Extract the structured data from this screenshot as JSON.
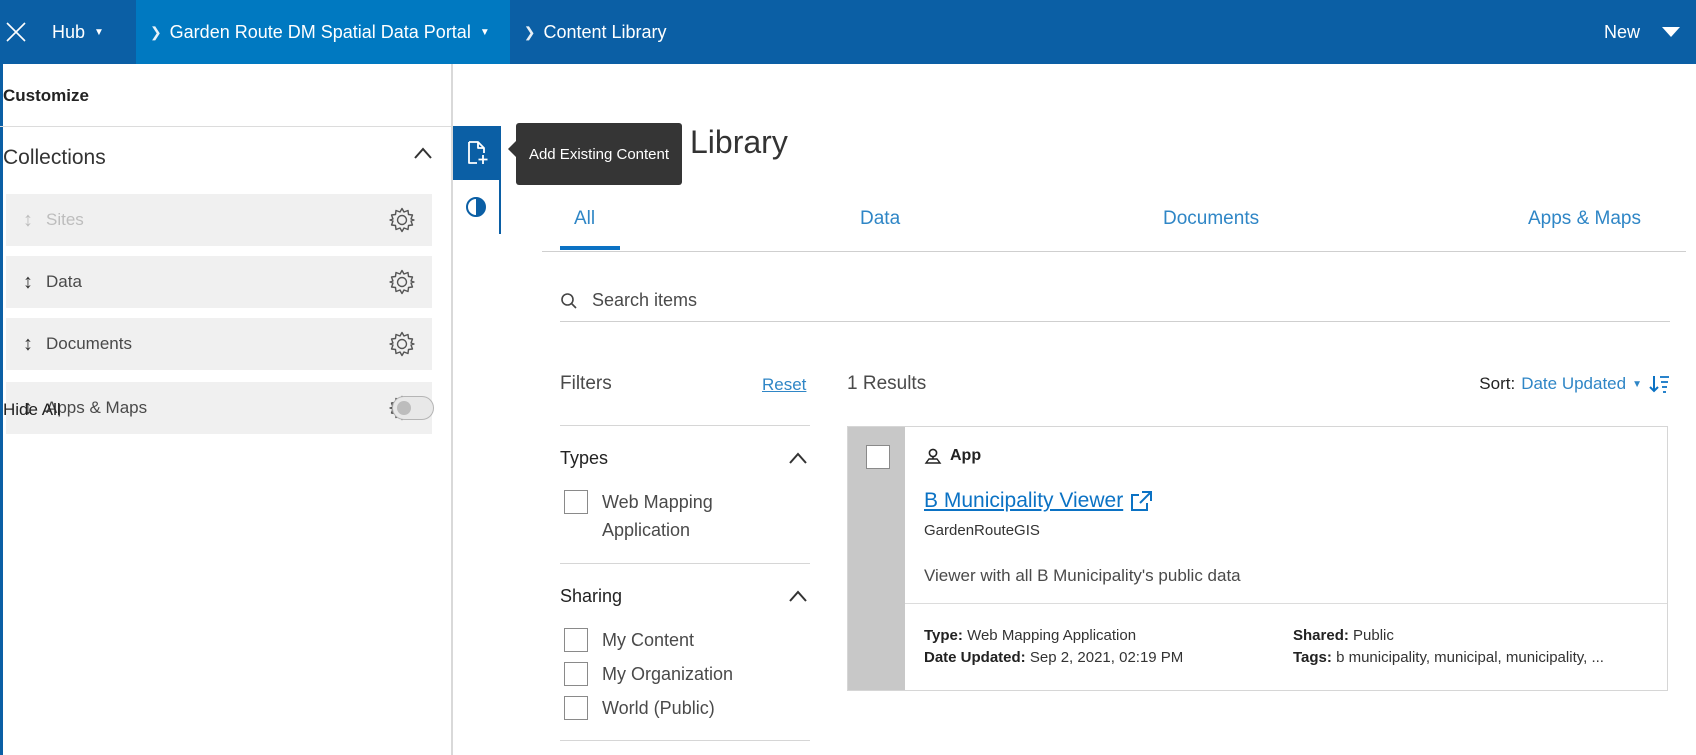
{
  "topbar": {
    "hub": "Hub",
    "portal": "Garden Route DM Spatial Data Portal",
    "page": "Content Library",
    "new_button": "New"
  },
  "customize": {
    "title": "Customize",
    "collections_title": "Collections",
    "items": [
      {
        "label": "Sites",
        "disabled": true
      },
      {
        "label": "Data",
        "disabled": false
      },
      {
        "label": "Documents",
        "disabled": false
      },
      {
        "label": "Apps & Maps",
        "disabled": false
      }
    ],
    "hide_all": "Hide All",
    "hide_all_on": false
  },
  "tooltip": "Add Existing Content",
  "library": {
    "title": "Library",
    "tabs": [
      "All",
      "Data",
      "Documents",
      "Apps & Maps"
    ],
    "active_tab": "All",
    "search_placeholder": "Search items"
  },
  "filters": {
    "title": "Filters",
    "reset": "Reset",
    "types_title": "Types",
    "types_options": [
      [
        "Web Mapping",
        "Application"
      ]
    ],
    "sharing_title": "Sharing",
    "sharing_options": [
      "My Content",
      "My Organization",
      "World (Public)"
    ]
  },
  "results": {
    "count_text": "1 Results",
    "sort_label": "Sort:",
    "sort_value": "Date Updated"
  },
  "card": {
    "kind": "App",
    "title": "B Municipality Viewer",
    "owner": "GardenRouteGIS",
    "description": "Viewer with all B Municipality's public data",
    "type_label": "Type:",
    "type_value": "Web Mapping Application",
    "date_label": "Date Updated:",
    "date_value": "Sep 2, 2021, 02:19 PM",
    "shared_label": "Shared:",
    "shared_value": "Public",
    "tags_label": "Tags:",
    "tags_value": "b municipality, municipal, municipality, ..."
  },
  "colors": {
    "brand_blue": "#0b5fa5",
    "active_crumb": "#0079c1",
    "link_blue": "#2f86c6"
  }
}
